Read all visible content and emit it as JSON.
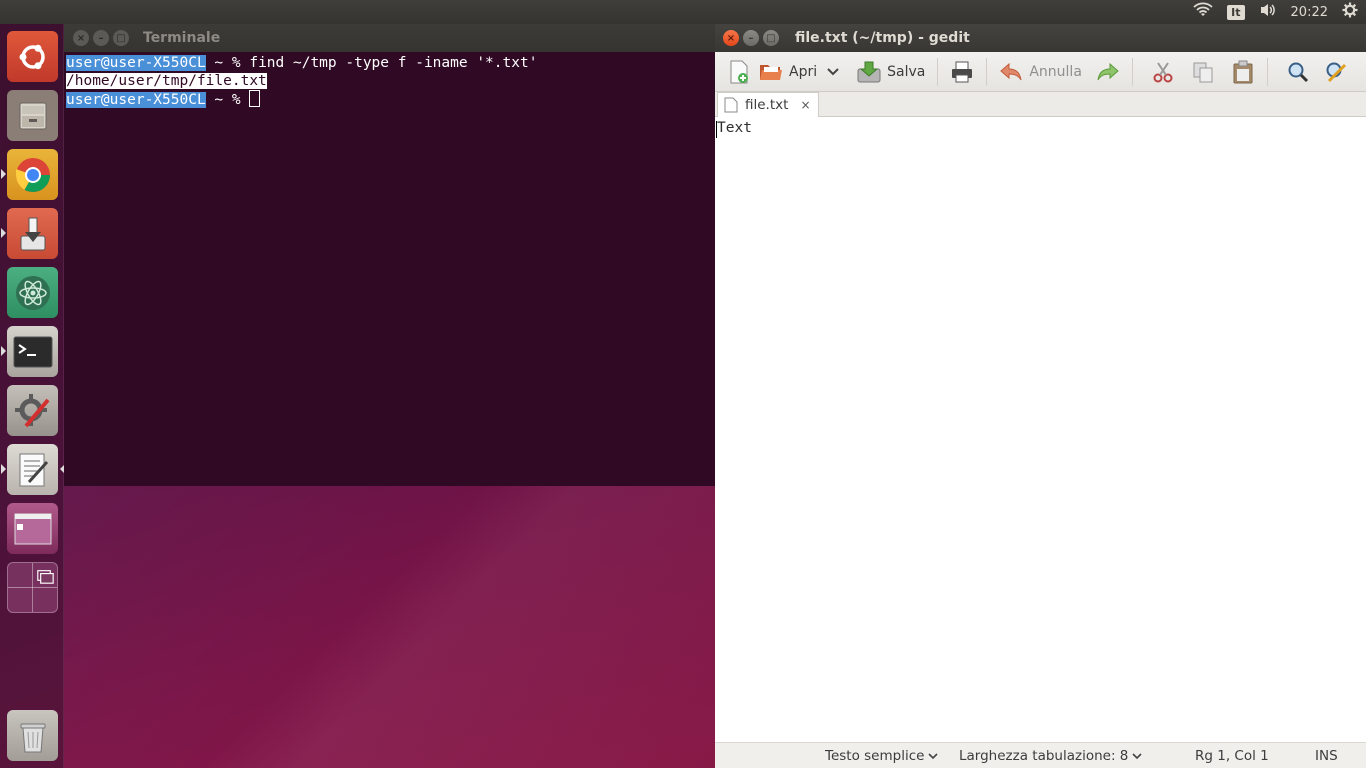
{
  "top_panel": {
    "keyboard_layout": "It",
    "clock": "20:22"
  },
  "launcher": {
    "items": [
      "ubuntu-dash",
      "files",
      "chrome",
      "installer",
      "atom",
      "terminal",
      "system-settings",
      "gedit",
      "workspace-switcher",
      "show-desktop",
      "trash"
    ]
  },
  "terminal": {
    "title": "Terminale",
    "prompt_user": "user@user-X550CL",
    "prompt_rest": " ~ % ",
    "command": "find ~/tmp -type f -iname '*.txt'",
    "output": "/home/user/tmp/file.txt"
  },
  "gedit": {
    "title": "file.txt (~/tmp) - gedit",
    "toolbar": {
      "open_label": "Apri",
      "save_label": "Salva",
      "undo_label": "Annulla"
    },
    "tab": {
      "label": "file.txt",
      "close": "×"
    },
    "content": "Text",
    "status": {
      "language": "Testo semplice",
      "tab_width": "Larghezza tabulazione: 8",
      "position": "Rg 1, Col 1",
      "mode": "INS"
    }
  },
  "colors": {
    "terminal_bg": "#300a24",
    "selection": "#4a90d9",
    "close_button": "#e95420"
  }
}
